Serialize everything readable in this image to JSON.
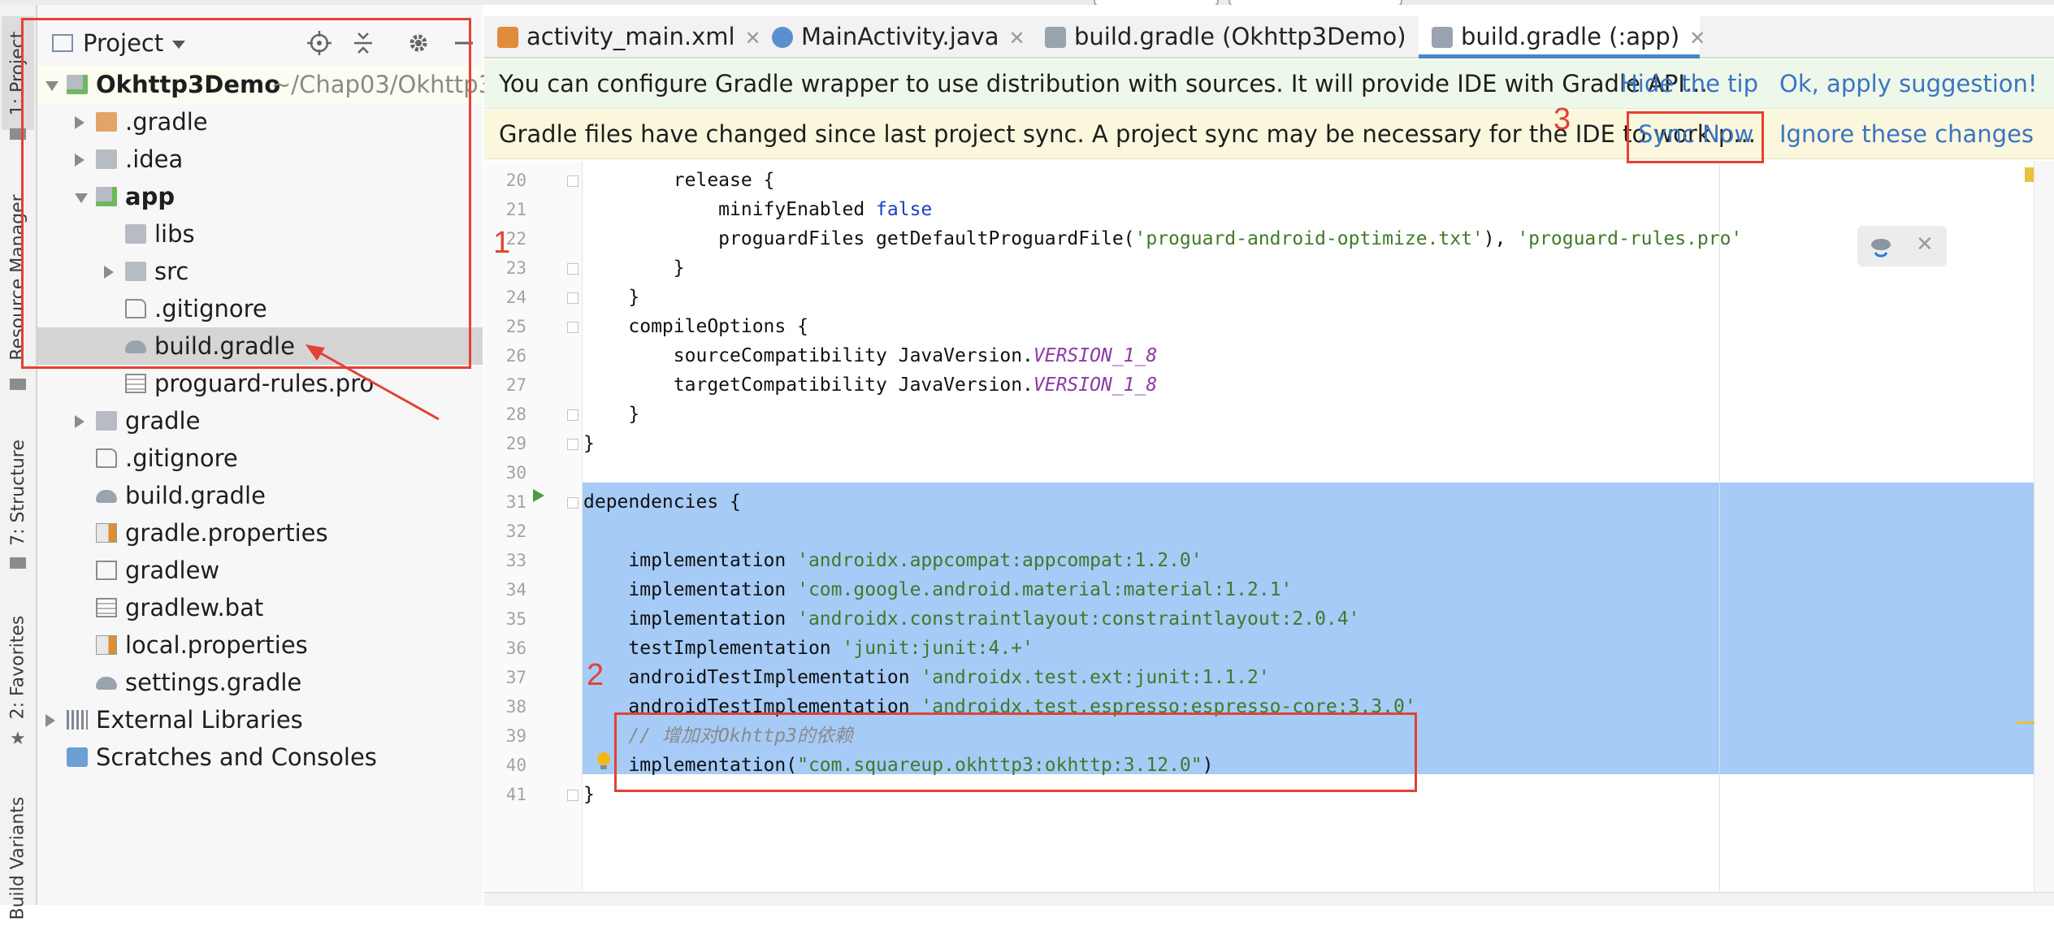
{
  "left_stripe": {
    "tabs": [
      "1: Project",
      "Resource Manager",
      "7: Structure",
      "2: Favorites",
      "Build Variants"
    ]
  },
  "project_panel": {
    "title": "Project",
    "header_icons": [
      "locate-icon",
      "collapse-icon",
      "gear-icon",
      "minimize-icon"
    ],
    "tree": [
      {
        "label": "Okhttp3Demo",
        "hint": "~/Chap03/Okhttp3",
        "type": "module",
        "bold": true,
        "expanded": true,
        "depth": 0
      },
      {
        "label": ".gradle",
        "type": "folder-orange",
        "expanded": false,
        "depth": 1
      },
      {
        "label": ".idea",
        "type": "folder",
        "expanded": false,
        "depth": 1
      },
      {
        "label": "app",
        "type": "module",
        "bold": true,
        "expanded": true,
        "depth": 1
      },
      {
        "label": "libs",
        "type": "folder",
        "depth": 2
      },
      {
        "label": "src",
        "type": "folder",
        "expanded": false,
        "depth": 2
      },
      {
        "label": ".gitignore",
        "type": "file-ignore",
        "depth": 2
      },
      {
        "label": "build.gradle",
        "type": "gradle",
        "depth": 2,
        "selected": true
      },
      {
        "label": "proguard-rules.pro",
        "type": "file-text",
        "depth": 2
      },
      {
        "label": "gradle",
        "type": "folder",
        "expanded": false,
        "depth": 1
      },
      {
        "label": ".gitignore",
        "type": "file-ignore",
        "depth": 1
      },
      {
        "label": "build.gradle",
        "type": "gradle",
        "depth": 1
      },
      {
        "label": "gradle.properties",
        "type": "file-props",
        "depth": 1
      },
      {
        "label": "gradlew",
        "type": "file-exec",
        "depth": 1
      },
      {
        "label": "gradlew.bat",
        "type": "file-text",
        "depth": 1
      },
      {
        "label": "local.properties",
        "type": "file-props",
        "depth": 1
      },
      {
        "label": "settings.gradle",
        "type": "gradle",
        "depth": 1
      },
      {
        "label": "External Libraries",
        "type": "libs",
        "expanded": false,
        "depth": 0
      },
      {
        "label": "Scratches and Consoles",
        "type": "scratch",
        "depth": 0
      }
    ]
  },
  "tabs": [
    {
      "label": "activity_main.xml",
      "icon": "xml-file-icon",
      "active": false
    },
    {
      "label": "MainActivity.java",
      "icon": "java-class-icon",
      "active": false
    },
    {
      "label": "build.gradle (Okhttp3Demo)",
      "icon": "gradle-icon",
      "active": false
    },
    {
      "label": "build.gradle (:app)",
      "icon": "gradle-icon",
      "active": true
    }
  ],
  "banner_wrapper": {
    "message": "You can configure Gradle wrapper to use distribution with sources. It will provide IDE with Gradle API...",
    "hide_tip": "Hide the tip",
    "apply": "Ok, apply suggestion!"
  },
  "banner_sync": {
    "message": "Gradle files have changed since last project sync. A project sync may be necessary for the IDE to work p...",
    "sync_now": "Sync Now",
    "ignore": "Ignore these changes"
  },
  "code_lines": [
    {
      "n": "20",
      "tokens": [
        [
          "",
          "        release {"
        ]
      ]
    },
    {
      "n": "21",
      "tokens": [
        [
          "",
          "            minifyEnabled "
        ],
        [
          "kw",
          "false"
        ]
      ]
    },
    {
      "n": "22",
      "tokens": [
        [
          "",
          "            proguardFiles getDefaultProguardFile("
        ],
        [
          "str",
          "'proguard-android-optimize.txt'"
        ],
        [
          "",
          "), "
        ],
        [
          "str",
          "'proguard-rules.pro'"
        ]
      ]
    },
    {
      "n": "23",
      "tokens": [
        [
          "",
          "        }"
        ]
      ]
    },
    {
      "n": "24",
      "tokens": [
        [
          "",
          "    }"
        ]
      ]
    },
    {
      "n": "25",
      "tokens": [
        [
          "",
          "    compileOptions {"
        ]
      ]
    },
    {
      "n": "26",
      "tokens": [
        [
          "",
          "        sourceCompatibility JavaVersion."
        ],
        [
          "const",
          "VERSION_1_8"
        ]
      ]
    },
    {
      "n": "27",
      "tokens": [
        [
          "",
          "        targetCompatibility JavaVersion."
        ],
        [
          "const",
          "VERSION_1_8"
        ]
      ]
    },
    {
      "n": "28",
      "tokens": [
        [
          "",
          "    }"
        ]
      ]
    },
    {
      "n": "29",
      "tokens": [
        [
          "",
          "}"
        ]
      ]
    },
    {
      "n": "30",
      "tokens": [
        [
          "",
          ""
        ]
      ]
    },
    {
      "n": "31",
      "tokens": [
        [
          "",
          "dependencies {"
        ]
      ],
      "selected": true
    },
    {
      "n": "32",
      "tokens": [
        [
          "",
          ""
        ]
      ],
      "selected": true
    },
    {
      "n": "33",
      "tokens": [
        [
          "",
          "    implementation "
        ],
        [
          "str",
          "'androidx.appcompat:appcompat:1.2.0'"
        ]
      ],
      "selected": true
    },
    {
      "n": "34",
      "tokens": [
        [
          "",
          "    implementation "
        ],
        [
          "str",
          "'com.google.android.material:material:1.2.1'"
        ]
      ],
      "selected": true
    },
    {
      "n": "35",
      "tokens": [
        [
          "",
          "    implementation "
        ],
        [
          "str",
          "'androidx.constraintlayout:constraintlayout:2.0.4'"
        ]
      ],
      "selected": true
    },
    {
      "n": "36",
      "tokens": [
        [
          "",
          "    testImplementation "
        ],
        [
          "str",
          "'junit:junit:4.+'"
        ]
      ],
      "selected": true
    },
    {
      "n": "37",
      "tokens": [
        [
          "",
          "    androidTestImplementation "
        ],
        [
          "str",
          "'androidx.test.ext:junit:1.1.2'"
        ]
      ],
      "selected": true
    },
    {
      "n": "38",
      "tokens": [
        [
          "",
          "    androidTestImplementation "
        ],
        [
          "str",
          "'androidx.test.espresso:espresso-core:3.3.0'"
        ]
      ],
      "selected": true
    },
    {
      "n": "39",
      "tokens": [
        [
          "comm",
          "    // 增加对Okhttp3的依赖"
        ]
      ],
      "selected": true
    },
    {
      "n": "40",
      "tokens": [
        [
          "",
          "    implementation("
        ],
        [
          "str",
          "\"com.squareup.okhttp3:okhttp:3.12.0\""
        ],
        [
          "",
          ")"
        ]
      ],
      "selected": true
    },
    {
      "n": "41",
      "tokens": [
        [
          "",
          "}"
        ]
      ]
    }
  ],
  "annotations": {
    "one": "1",
    "two": "2",
    "three": "3"
  },
  "colors": {
    "accent": "#4a86c8",
    "annotation": "#e34234",
    "selection": "#a6cbf7",
    "link": "#3b74c2"
  }
}
